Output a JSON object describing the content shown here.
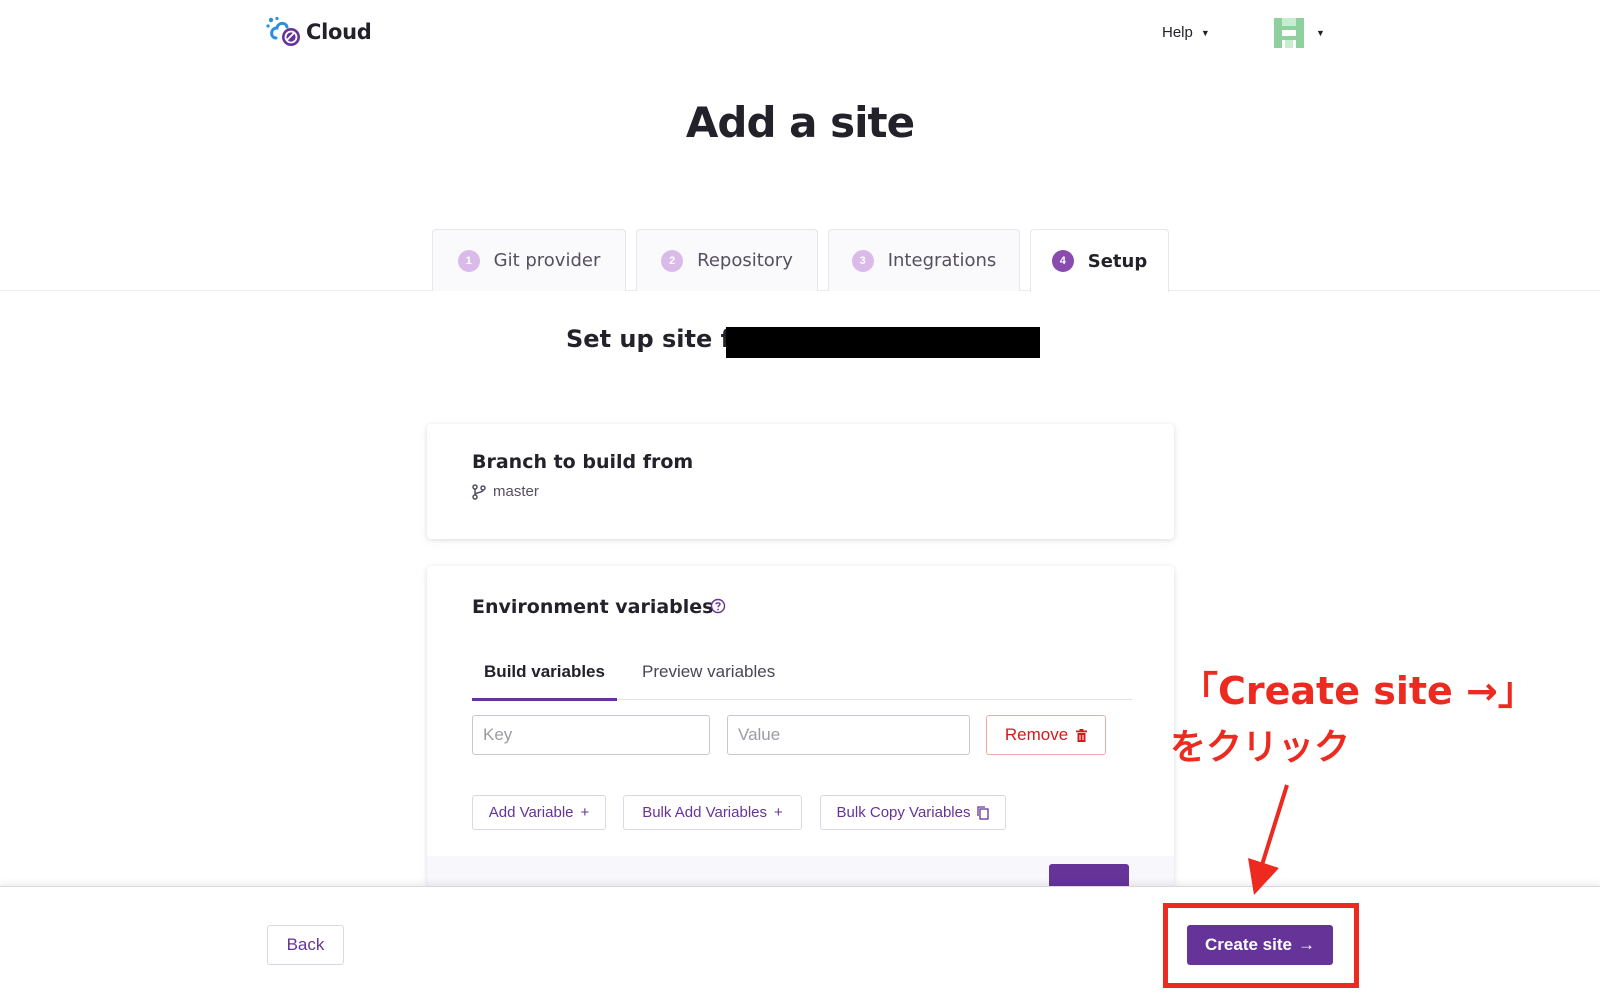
{
  "header": {
    "logo_text": "Cloud",
    "help_label": "Help",
    "user_menu": "user avatar menu"
  },
  "page_title": "Add a site",
  "steps": [
    {
      "number": "1",
      "label": "Git provider",
      "active": false
    },
    {
      "number": "2",
      "label": "Repository",
      "active": false
    },
    {
      "number": "3",
      "label": "Integrations",
      "active": false
    },
    {
      "number": "4",
      "label": "Setup",
      "active": true
    }
  ],
  "setup_title": "Set up site for",
  "branch_card": {
    "title": "Branch to build from",
    "branch": "master",
    "icon": "git-branch-icon"
  },
  "env_card": {
    "title": "Environment variables",
    "tabs": [
      "Build variables",
      "Preview variables"
    ],
    "key_placeholder": "Key",
    "value_placeholder": "Value",
    "remove_label": "Remove",
    "add_variable_label": "Add Variable",
    "bulk_add_label": "Bulk Add Variables",
    "bulk_copy_label": "Bulk Copy Variables"
  },
  "footer": {
    "back_label": "Back",
    "create_label": "Create site"
  },
  "annotation": {
    "line1": "「Create site →」",
    "line2": "をクリック",
    "color": "#ec2a1f"
  },
  "colors": {
    "brand": "#663399",
    "step_active": "#8a4baf",
    "step_inactive": "#d9bae8",
    "danger": "#d01c1c"
  }
}
